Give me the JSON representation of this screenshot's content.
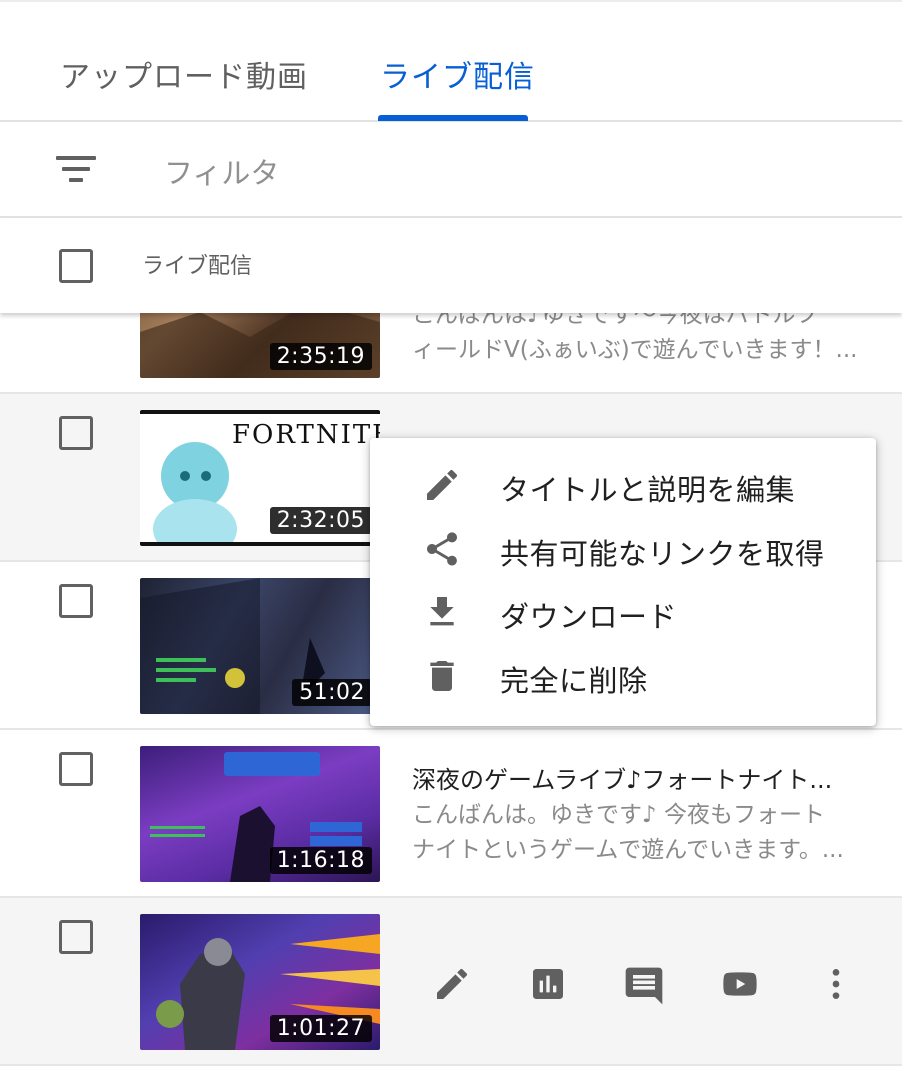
{
  "tabs": [
    {
      "label": "アップロード動画",
      "selected": false
    },
    {
      "label": "ライブ配信",
      "selected": true
    }
  ],
  "filter": {
    "placeholder": "フィルタ",
    "icon": "filter-list-icon"
  },
  "list_header": {
    "label": "ライブ配信"
  },
  "videos": [
    {
      "duration": "2:35:19",
      "title": "",
      "desc_line1": "こんばんは♪ゆきです～今夜はバトルフ",
      "desc_line2": "ィールドV(ふぁいぶ)で遊んでいきます！..."
    },
    {
      "duration": "2:32:05",
      "title": "",
      "desc_line1": "",
      "desc_line2": "",
      "thumb_text": "FORTNITE"
    },
    {
      "duration": "51:02",
      "title": "",
      "desc_line1": "",
      "desc_line2": ""
    },
    {
      "duration": "1:16:18",
      "title": "深夜のゲームライブ♪フォートナイト...",
      "desc_line1": "こんばんは。ゆきです♪ 今夜もフォート",
      "desc_line2": "ナイトというゲームで遊んでいきます。..."
    },
    {
      "duration": "1:01:27",
      "title": "",
      "desc_line1": "",
      "desc_line2": ""
    }
  ],
  "context_menu": [
    {
      "label": "タイトルと説明を編集",
      "icon": "pencil-icon"
    },
    {
      "label": "共有可能なリンクを取得",
      "icon": "share-icon"
    },
    {
      "label": "ダウンロード",
      "icon": "download-icon"
    },
    {
      "label": "完全に削除",
      "icon": "trash-icon"
    }
  ],
  "row_actions": [
    "pencil-icon",
    "analytics-icon",
    "comments-icon",
    "youtube-icon",
    "more-vert-icon"
  ],
  "colors": {
    "accent": "#065fd4",
    "icon": "#606060",
    "text": "#202020",
    "muted": "#8a8a8a"
  }
}
